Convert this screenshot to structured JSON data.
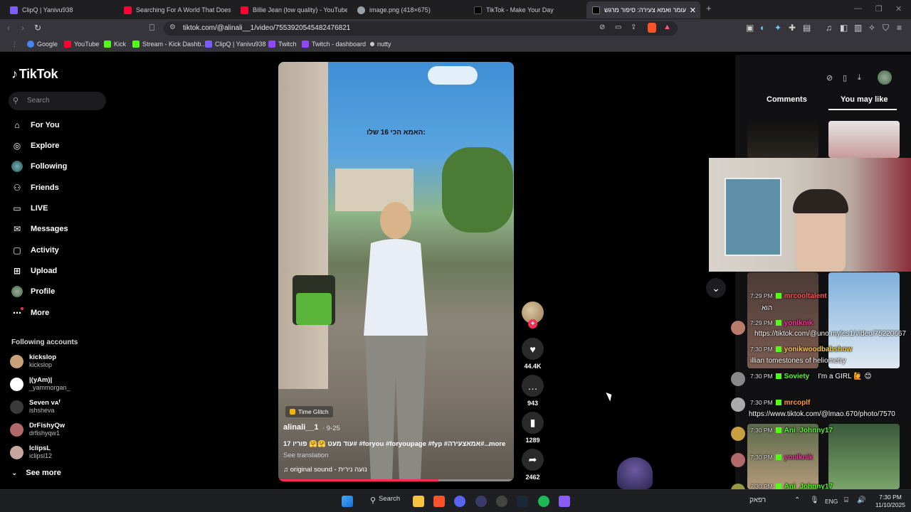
{
  "browser": {
    "tabs": [
      {
        "title": "ClipQ | Yanivu938",
        "color": "#7a5cff"
      },
      {
        "title": "Searching For A World That Doesn't",
        "color": "#ff0033"
      },
      {
        "title": "Billie Jean (low quality) - YouTube",
        "color": "#ff0033"
      },
      {
        "title": "image.png (418×675)",
        "color": "#9aa0a6"
      },
      {
        "title": "TikTok - Make Your Day",
        "color": "#000000"
      },
      {
        "title": "עומר ואמא צעירה: סיפור מרגש",
        "color": "#000000"
      }
    ],
    "url": "tiktok.com/@alinali__1/video/7553920545482476821",
    "bookmarks": [
      {
        "label": "Google",
        "color": "#4285f4"
      },
      {
        "label": "YouTube",
        "color": "#ff0033"
      },
      {
        "label": "Kick",
        "color": "#53fc18"
      },
      {
        "label": "Stream - Kick Dashb...",
        "color": "#53fc18"
      },
      {
        "label": "ClipQ | Yanivu938",
        "color": "#7a5cff"
      },
      {
        "label": "Twitch",
        "color": "#9146ff"
      },
      {
        "label": "Twitch - dashboard",
        "color": "#9146ff"
      },
      {
        "label": "nutty",
        "color": "#cccccc"
      }
    ]
  },
  "sidebar": {
    "logo": "TikTok",
    "search_placeholder": "Search",
    "nav": [
      {
        "label": "For You",
        "icon": "home-icon"
      },
      {
        "label": "Explore",
        "icon": "compass-icon"
      },
      {
        "label": "Following",
        "icon": "following-icon"
      },
      {
        "label": "Friends",
        "icon": "friends-icon"
      },
      {
        "label": "LIVE",
        "icon": "live-icon"
      },
      {
        "label": "Messages",
        "icon": "messages-icon"
      },
      {
        "label": "Activity",
        "icon": "activity-icon"
      },
      {
        "label": "Upload",
        "icon": "upload-icon"
      },
      {
        "label": "Profile",
        "icon": "profile-icon"
      },
      {
        "label": "More",
        "icon": "more-icon"
      }
    ],
    "following_title": "Following accounts",
    "accounts": [
      {
        "name": "kickslop",
        "handle": "kickslop",
        "color": "#c9a27a"
      },
      {
        "name": "|(yAm)|",
        "handle": "_yammorgan_",
        "color": "#ffffff"
      },
      {
        "name": "Seven ᴠᴀᶠ",
        "handle": "ishsheva",
        "color": "#3a3a3a"
      },
      {
        "name": "DrFishyQw",
        "handle": "drfishyqw1",
        "color": "#b06a6a"
      },
      {
        "name": "lclipsL",
        "handle": "iclipsl12",
        "color": "#c7a8a0"
      }
    ],
    "see_more": "See more"
  },
  "video": {
    "overlay_text": "האמא הכי 16 שלו:",
    "effect": "Time Glitch",
    "author": "alinali__1",
    "date": "· 9-25",
    "caption": "17 עוד מעט 🤗🤗 פוריו# #foryou #foryoupage #fyp #אמאצעירה#...",
    "more": "more",
    "see_translation": "See translation",
    "sound": "♫  original sound - נועה נירית",
    "progress": 0.68
  },
  "actions": {
    "likes": "44.4K",
    "comments": "943",
    "saves": "1289",
    "shares": "2462"
  },
  "right_panel": {
    "tabs": [
      "Comments",
      "You may like"
    ],
    "active_tab": 1
  },
  "chat": [
    {
      "time": "7:29 PM",
      "user": "mrcooltalent",
      "msg": "הוא",
      "ucolor": "#ff5555"
    },
    {
      "time": "7:29 PM",
      "user": "yonlknik",
      "msg": "https://tiktok.com/@uno.myles1/video/75220667",
      "ucolor": "#ff3399"
    },
    {
      "time": "7:30 PM",
      "user": "yonikwoodbabshow",
      "msg": "illian tomestones of heliometry",
      "ucolor": "#ffcc33"
    },
    {
      "time": "7:30 PM",
      "user": "Soviety",
      "msg": "I'm a GIRL 🙋 😊",
      "ucolor": "#53fc18"
    },
    {
      "time": "7:30 PM",
      "user": "mrcoplf",
      "msg": "https://www.tiktok.com/@lmao.670/photo/7570",
      "ucolor": "#ff9933"
    },
    {
      "time": "7:30 PM",
      "user": "Ani_Johnny17",
      "msg": "",
      "ucolor": "#53fc18"
    },
    {
      "time": "7:30 PM",
      "user": "yonlknik",
      "msg": "",
      "ucolor": "#ff3399"
    },
    {
      "time": "7:30 PM",
      "user": "Ani_Johnny17",
      "msg": "",
      "ucolor": "#53fc18"
    }
  ],
  "taskbar": {
    "search": "Search",
    "weather": "רפאק",
    "lang": "ENG",
    "time": "7:30 PM",
    "date": "11/10/2025"
  }
}
